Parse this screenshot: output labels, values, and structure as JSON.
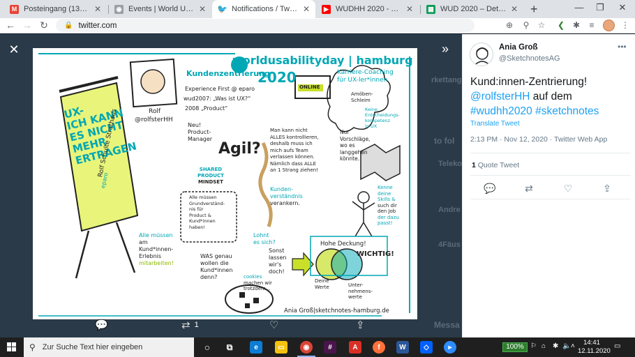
{
  "browser": {
    "tabs": [
      {
        "title": "Posteingang (132) - saskia.w...",
        "favicon": "gmail-icon",
        "favicon_color": "#ea4335",
        "active": false
      },
      {
        "title": "Events | World Usability Day",
        "favicon": "wud-icon",
        "favicon_color": "#9aa0a6",
        "active": false
      },
      {
        "title": "Notifications / Twitter",
        "favicon": "twitter-icon",
        "favicon_color": "#1da1f2",
        "active": true
      },
      {
        "title": "WUDHH 2020 - YouTube",
        "favicon": "youtube-icon",
        "favicon_color": "#ff0000",
        "active": false
      },
      {
        "title": "WUD 2020 – Detaillierter Ab...",
        "favicon": "sheets-icon",
        "favicon_color": "#0f9d58",
        "active": false
      }
    ],
    "url": "twitter.com"
  },
  "viewer": {
    "background_text": [
      "rkettang",
      "to fol",
      "Teleko",
      "Andre",
      "4Fäus",
      "Messa"
    ],
    "actions": {
      "reply_count": "",
      "retweet_count": "1",
      "like_count": ""
    }
  },
  "sketchnote": {
    "logo": "worldusabilityday | hamburg",
    "year": "2020",
    "online_badge": "ONLINE",
    "flipchart": [
      "UX-",
      "ICH KANN",
      "ES NICHT",
      "MEHR",
      "ERTRAGEN"
    ],
    "flipchart_credit": "Rolf Schulte Strathaus",
    "flipchart_company": "eparo",
    "portrait_name": "Rolf",
    "portrait_handle": "@rolfsterHH",
    "kundenzentrierung": "Kundenzentrierung",
    "experience_first": "Experience First @ eparo",
    "wud2007": "wud2007: „Was ist UX?“",
    "product_2008": "2008 „Product“",
    "neu_pm": "Neu! Product-Manager",
    "agil": "Agil?",
    "shared_mindset": [
      "SHARED",
      "PRODUCT",
      "MINDSET"
    ],
    "kontrollieren": [
      "Man kann nicht",
      "ALLES kontrollieren,",
      "deshalb muss ich",
      "mich aufs Team",
      "verlassen können.",
      "Nämlich dass ALLE",
      "an 1 Strang ziehen!"
    ],
    "kundenverstaendnis": [
      "Kunden-",
      "verständnis",
      "verankern."
    ],
    "karriere": [
      "Karriere-Coaching",
      "für UX-ler*innen"
    ],
    "amoeben": [
      "Amöben-",
      "Schleim"
    ],
    "keine_kompetenz": [
      "Keine",
      "Entscheidungs-",
      "kompetenz",
      "in UX"
    ],
    "nur_vorschlaege": [
      "Nur",
      "Vorschläge,",
      "wo es",
      "langgehen",
      "könnte."
    ],
    "kenne_skills": [
      "Kenne",
      "deine",
      "Skills &",
      "such dir",
      "den Job",
      "der dazu",
      "passt!"
    ],
    "grundverstaendnis": [
      "Alle müssen",
      "Grundverständ-",
      "nis für",
      "Product &",
      "Kund*innen",
      "haben!"
    ],
    "alle_muessen": [
      "Alle müssen",
      "am",
      "Kund*innen-",
      "Erlebnis",
      "mitarbeiten!"
    ],
    "was_wollen": [
      "WAS genau",
      "wollen die",
      "Kund*innen",
      "denn?"
    ],
    "lohnt": [
      "Lohnt",
      "es sich?"
    ],
    "sonst": [
      "Sonst",
      "lassen",
      "wir's",
      "doch!"
    ],
    "hohe_deckung": "Hohe Deckung!",
    "wichtig": "WICHTIG!",
    "deine_werte": [
      "Deine",
      "Werte"
    ],
    "unternehmenswerte": [
      "Unter-",
      "nehmens-",
      "werte"
    ],
    "cookies": [
      "cookies",
      "machen wir",
      "trotzdem..."
    ],
    "signature": "Ania Groß|sketchnotes-hamburg.de"
  },
  "tweet": {
    "author_name": "Ania Groß",
    "author_handle": "@SketchnotesAG",
    "text_plain": "Kund:innen-Zentrierung!",
    "mention": "@rolfsterHH",
    "text_mid": " auf dem",
    "hashtag1": "#wudhh2020",
    "hashtag2": "#sketchnotes",
    "translate": "Translate Tweet",
    "meta": "2:13 PM · Nov 12, 2020 · Twitter Web App",
    "quote_count": "1",
    "quote_label": "Quote Tweet"
  },
  "taskbar": {
    "search_placeholder": "Zur Suche Text hier eingeben",
    "battery": "100%",
    "time": "14:41",
    "date": "12.11.2020"
  }
}
